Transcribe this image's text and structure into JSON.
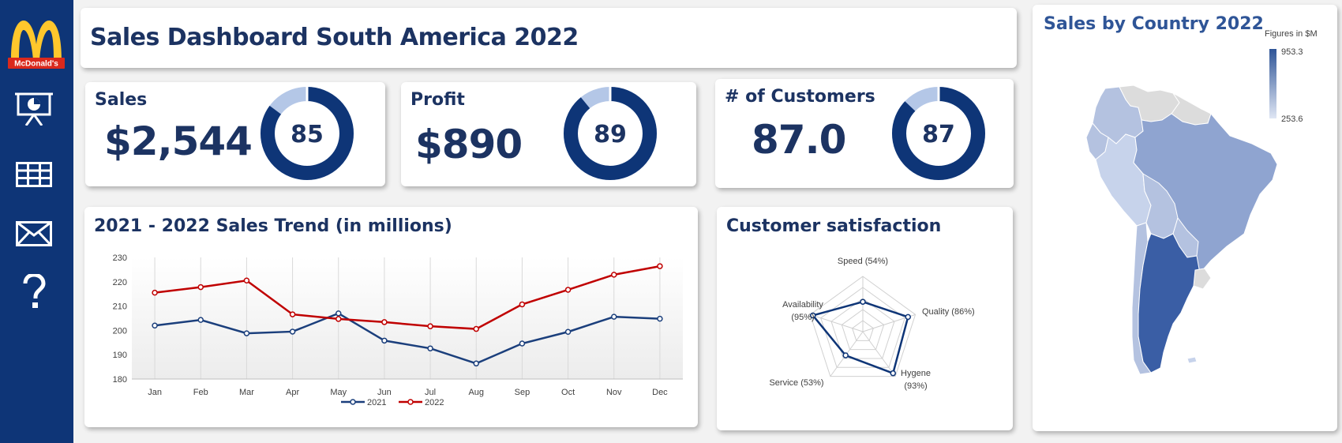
{
  "dashboard": {
    "title": "Sales Dashboard South America 2022",
    "logo_text": "McDonald's"
  },
  "sidebar": {
    "items": [
      {
        "name": "presentation",
        "icon": "presentation-chart-icon"
      },
      {
        "name": "table",
        "icon": "table-grid-icon"
      },
      {
        "name": "mail",
        "icon": "envelope-icon"
      },
      {
        "name": "help",
        "icon": "question-mark-icon"
      }
    ]
  },
  "kpis": [
    {
      "title": "Sales",
      "value": "$2,544",
      "percent": 85,
      "percent_label": "85"
    },
    {
      "title": "Profit",
      "value": "$890",
      "percent": 89,
      "percent_label": "89"
    },
    {
      "title": "# of Customers",
      "value": "87.0",
      "percent": 87,
      "percent_label": "87"
    }
  ],
  "colors": {
    "primary": "#0e3577",
    "donut_light": "#b4c7e7",
    "series_2021": "#1b3f7c",
    "series_2022": "#c00000"
  },
  "chart_data": [
    {
      "type": "line",
      "title": "2021 - 2022  Sales Trend (in millions)",
      "categories": [
        "Jan",
        "Feb",
        "Mar",
        "Apr",
        "May",
        "Jun",
        "Jul",
        "Aug",
        "Sep",
        "Oct",
        "Nov",
        "Dec"
      ],
      "series": [
        {
          "name": "2021",
          "values": [
            202,
            204.3,
            198.8,
            199.5,
            207,
            195.8,
            192.6,
            186.4,
            194.6,
            199.4,
            205.6,
            204.8
          ]
        },
        {
          "name": "2022",
          "values": [
            215.5,
            217.8,
            220.5,
            206.6,
            204.7,
            203.4,
            201.7,
            200.6,
            210.7,
            216.7,
            222.9,
            226.4
          ]
        }
      ],
      "ylim": [
        180,
        230
      ],
      "yticks": [
        "180",
        "190",
        "200",
        "210",
        "220",
        "230"
      ],
      "grid": true,
      "legend": "bottom"
    },
    {
      "type": "radar",
      "title": "Customer satisfaction",
      "axes": [
        {
          "label": "Speed (54%)",
          "value": 54
        },
        {
          "label": "Quality (86%)",
          "value": 86
        },
        {
          "label": "Hygene",
          "label2": "(93%)",
          "value": 93
        },
        {
          "label": "Service (53%)",
          "value": 53
        },
        {
          "label": "Availability",
          "label2": "(95%)",
          "value": 95
        }
      ],
      "range": [
        0,
        100
      ]
    },
    {
      "type": "map",
      "title": "Sales by Country 2022",
      "legend_title": "Figures in $M",
      "legend_max": "953.3",
      "legend_min": "253.6",
      "color_max": "#2f5597",
      "color_min": "#dfe6f4"
    }
  ]
}
